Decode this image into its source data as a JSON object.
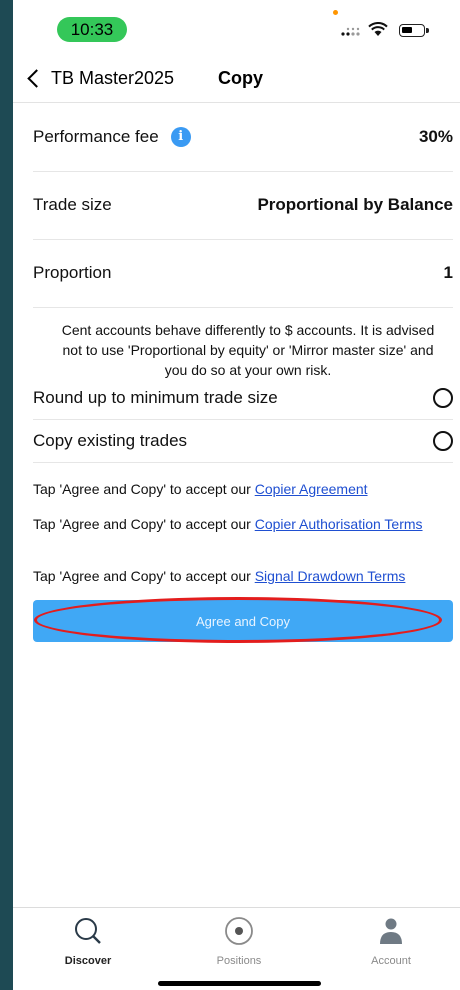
{
  "status_bar": {
    "time": "10:33"
  },
  "nav": {
    "back_label": "TB Master2025",
    "title": "Copy"
  },
  "settings": {
    "performance_fee": {
      "label": "Performance fee",
      "value": "30%"
    },
    "trade_size": {
      "label": "Trade size",
      "value": "Proportional by Balance"
    },
    "proportion": {
      "label": "Proportion",
      "value": "1"
    }
  },
  "note": "Cent accounts behave differently to $ accounts. It is advised not to use 'Proportional by equity' or 'Mirror master size' and you do so at your own risk.",
  "options": {
    "round_up": "Round up to minimum trade size",
    "copy_existing": "Copy existing trades"
  },
  "terms": {
    "prefix": "Tap 'Agree and Copy' to accept our ",
    "copier_agreement": "Copier Agreement",
    "copier_authorisation": "Copier Authorisation Terms",
    "signal_drawdown": "Signal Drawdown Terms"
  },
  "agree_button": "Agree and Copy",
  "tabs": {
    "discover": "Discover",
    "positions": "Positions",
    "account": "Account"
  },
  "colors": {
    "accent": "#40a8f5",
    "highlight": "#e31d1d",
    "link": "#1f4fd1",
    "status_pill": "#34c759"
  }
}
